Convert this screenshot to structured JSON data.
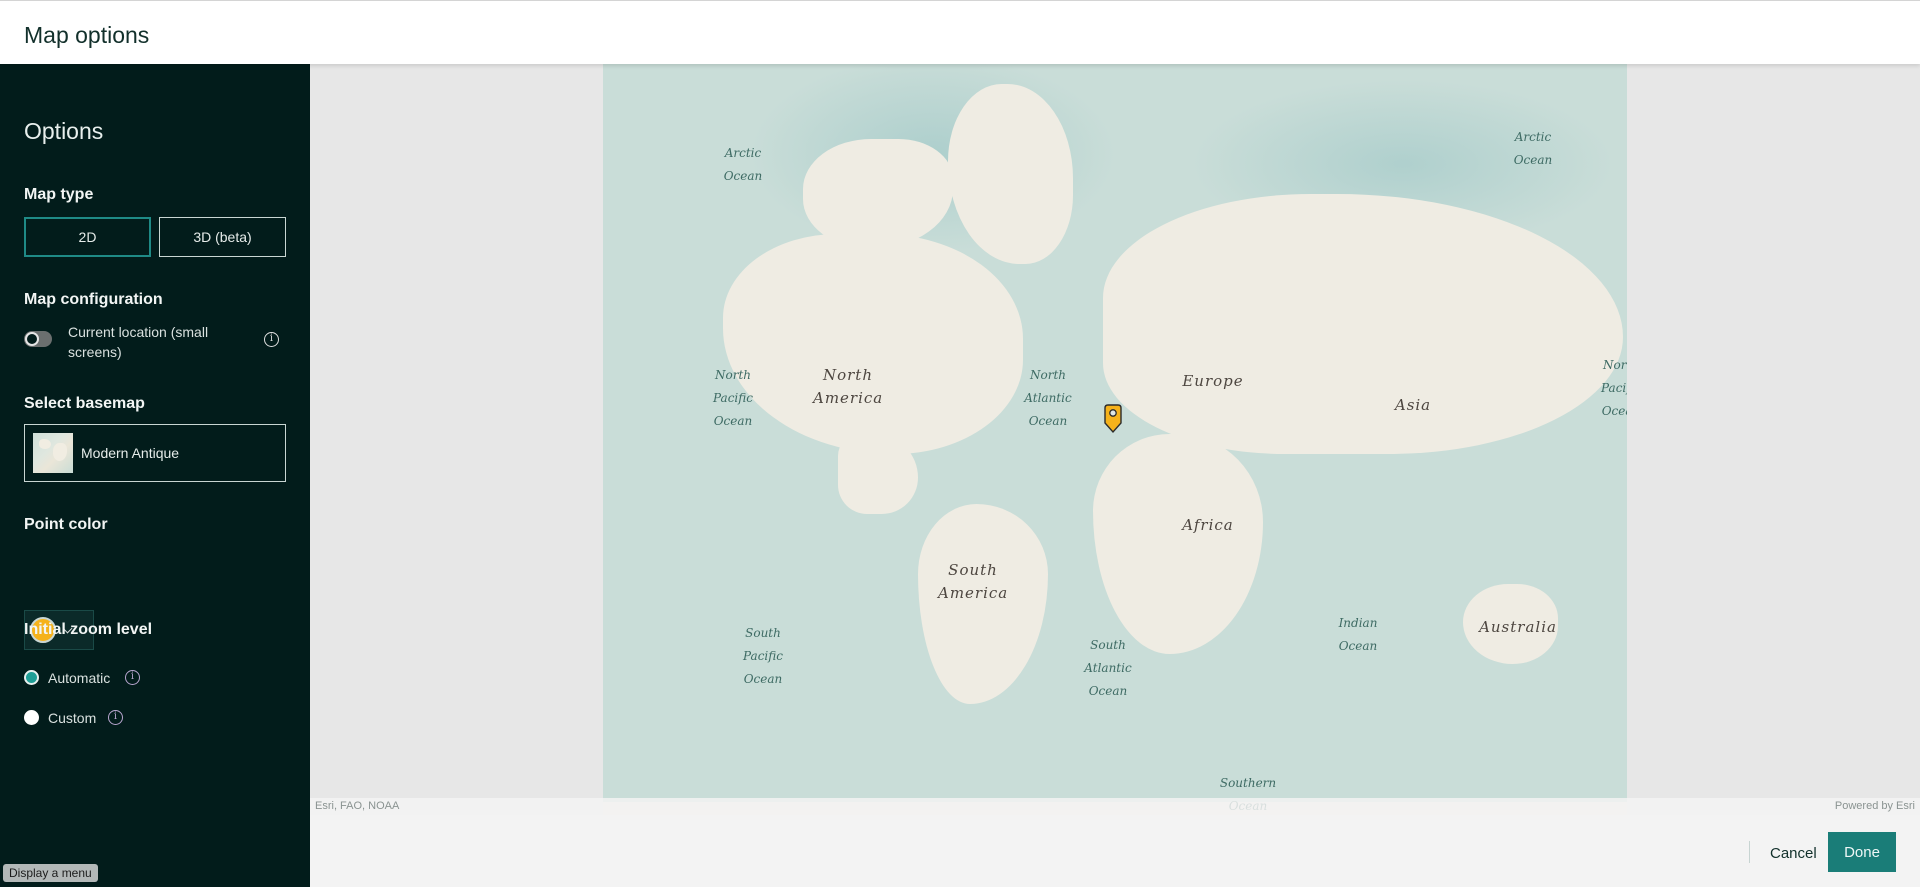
{
  "header": {
    "title": "Map options"
  },
  "sidebar": {
    "title": "Options",
    "map_type": {
      "label": "Map type",
      "options": [
        "2D",
        "3D (beta)"
      ],
      "selected": "2D"
    },
    "map_config": {
      "label": "Map configuration",
      "current_location_label": "Current location (small screens)",
      "current_location_enabled": false
    },
    "basemap": {
      "label": "Select basemap",
      "selected": "Modern Antique"
    },
    "point_color": {
      "label": "Point color",
      "value": "#f5b21b"
    },
    "zoom_level": {
      "label": "Initial zoom level",
      "options": [
        "Automatic",
        "Custom"
      ],
      "selected": "Automatic"
    }
  },
  "tooltip": "Display a menu",
  "map": {
    "labels": {
      "arctic_left": "Arctic Ocean",
      "arctic_right": "Arctic Ocean",
      "north_america": "North America",
      "north_pacific_left": "North Pacific Ocean",
      "north_pacific_right": "North Pacific Ocean",
      "north_atlantic": "North Atlantic Ocean",
      "europe": "Europe",
      "asia": "Asia",
      "africa": "Africa",
      "south_america": "South America",
      "south_pacific": "South Pacific Ocean",
      "south_atlantic": "South Atlantic Ocean",
      "indian": "Indian Ocean",
      "australia": "Australia",
      "southern": "Southern Ocean"
    },
    "attribution": "Esri, FAO, NOAA",
    "powered_by": "Powered by Esri"
  },
  "footer": {
    "cancel": "Cancel",
    "done": "Done"
  }
}
